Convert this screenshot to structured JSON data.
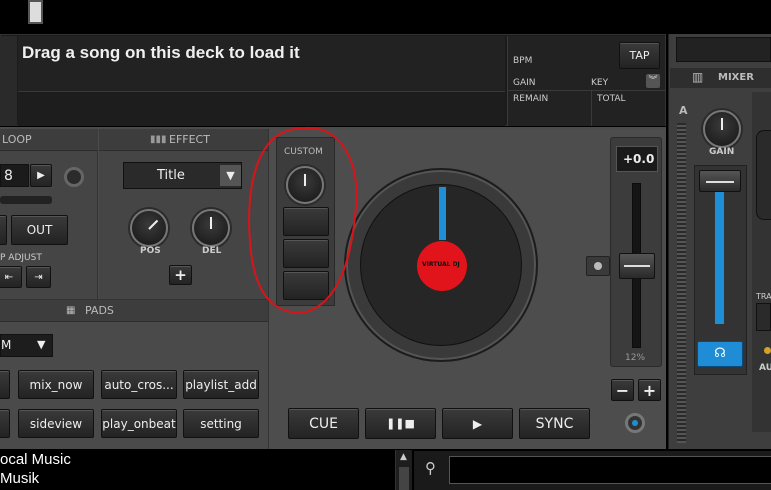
{
  "deck": {
    "load_hint": "Drag a song on this deck to load it",
    "bpm_label": "BPM",
    "tap_label": "TAP",
    "gain_label": "GAIN",
    "key_label": "KEY",
    "remain_label": "REMAIN",
    "total_label": "TOTAL"
  },
  "loop": {
    "title": "LOOP",
    "length": "8",
    "out_label": "OUT",
    "adjust_label": "P ADJUST"
  },
  "effect": {
    "title": "EFFECT",
    "select_value": "Title",
    "pos_label": "POS",
    "del_label": "DEL",
    "add_label": "+"
  },
  "custom": {
    "title": "CUSTOM"
  },
  "pads": {
    "title": "PADS",
    "mode_value": "M",
    "row1": [
      "",
      "mix_now",
      "auto_cros...",
      "playlist_add"
    ],
    "row2": [
      "",
      "sideview",
      "play_onbeat",
      "setting"
    ]
  },
  "transport": {
    "cue_label": "CUE",
    "play_pause_label": "❚❚■",
    "play_label": "▶",
    "sync_label": "SYNC"
  },
  "platter": {
    "logo_text": "VIRTUAL DJ"
  },
  "pitch": {
    "value": "+0.0",
    "range": "12%",
    "minus_label": "−",
    "plus_label": "+"
  },
  "mixer": {
    "title": "MIXER",
    "deck_letter": "A",
    "gain_label": "GAIN",
    "tra_label": "TRA",
    "au_label": "AU"
  },
  "browser": {
    "folders": [
      "ocal Music",
      "Musik"
    ],
    "search_placeholder": ""
  },
  "colors": {
    "accent_blue": "#1e8fd6",
    "platter_red": "#e0141a",
    "annotation_red": "#d8141a"
  }
}
